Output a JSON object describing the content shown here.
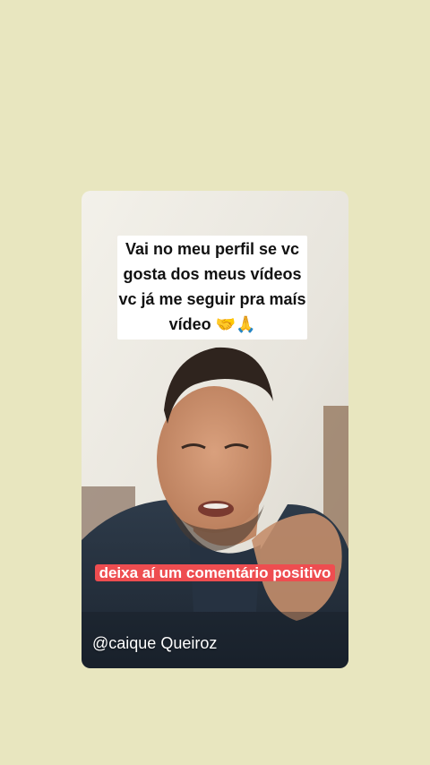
{
  "video": {
    "caption_top": "Vai no meu perfil se vc gosta dos meus vídeos vc já me seguir pra maís vídeo 🤝🙏",
    "caption_bottom": "deixa aí um comentário positivo",
    "username": "@caique Queiroz"
  },
  "colors": {
    "page_background": "#e8e6bf",
    "caption_highlight": "#ee4d50"
  }
}
